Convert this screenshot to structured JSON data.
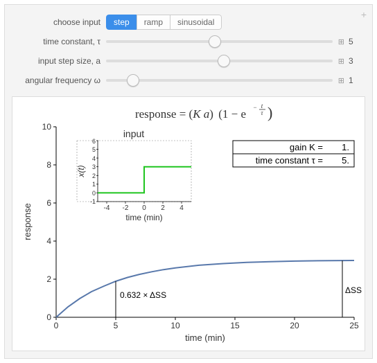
{
  "controls": {
    "choose_label": "choose input",
    "options": {
      "step": "step",
      "ramp": "ramp",
      "sinusoidal": "sinusoidal"
    },
    "tau": {
      "label": "time constant, τ",
      "value": "5"
    },
    "a": {
      "label": "input step size, a",
      "value": "3"
    },
    "w": {
      "label": "angular frequency ω",
      "value": "1"
    }
  },
  "plus_glyph": "+",
  "eq": {
    "response_text": "response = (",
    "Ka": "K a",
    "rparen": ")",
    "lparen2": "(",
    "one_minus": "1 − e",
    "frac_t": "t",
    "frac_tau": "τ",
    "rparen2": ")"
  },
  "main_plot": {
    "xlabel": "time (min)",
    "ylabel": "response",
    "x_ticks": [
      "0",
      "5",
      "10",
      "15",
      "20",
      "25"
    ],
    "y_ticks": [
      "0",
      "2",
      "4",
      "6",
      "8",
      "10"
    ],
    "tau_label": "0.632 × ΔSS",
    "ss_label": "ΔSS"
  },
  "inset": {
    "title": "input",
    "xlabel": "time (min)",
    "ylabel": "x(t)",
    "x_ticks": [
      "-4",
      "-2",
      "0",
      "2",
      "4"
    ],
    "y_ticks": [
      "-1",
      "0",
      "1",
      "2",
      "3",
      "4",
      "5",
      "6"
    ]
  },
  "params_box": {
    "k_label": "gain K =",
    "k_value": "1.",
    "tau_label": "time constant  τ =",
    "tau_value": "5."
  },
  "chart_data": {
    "type": "line",
    "title": "response = (K a)(1 − e^(−t/τ))",
    "xlabel": "time (min)",
    "ylabel": "response",
    "x": [
      0,
      1,
      2,
      3,
      4,
      5,
      6,
      7,
      8,
      9,
      10,
      12,
      14,
      16,
      18,
      20,
      22,
      25
    ],
    "values": [
      0,
      0.544,
      0.989,
      1.353,
      1.651,
      1.896,
      2.096,
      2.26,
      2.394,
      2.503,
      2.594,
      2.728,
      2.818,
      2.878,
      2.918,
      2.945,
      2.963,
      2.98
    ],
    "xlim": [
      0,
      25
    ],
    "ylim": [
      0,
      10
    ],
    "annotations": [
      {
        "x": 5,
        "y": 1.896,
        "text": "0.632 × ΔSS"
      },
      {
        "x": 24,
        "y": 2.97,
        "text": "ΔSS"
      }
    ],
    "inset": {
      "type": "line",
      "title": "input",
      "xlabel": "time (min)",
      "ylabel": "x(t)",
      "x": [
        -5,
        -0.01,
        0,
        5
      ],
      "values": [
        0,
        0,
        3,
        3
      ],
      "xlim": [
        -5,
        5
      ],
      "ylim": [
        -1,
        6
      ]
    },
    "params": {
      "K": 1.0,
      "tau": 5.0,
      "a": 3.0
    }
  }
}
